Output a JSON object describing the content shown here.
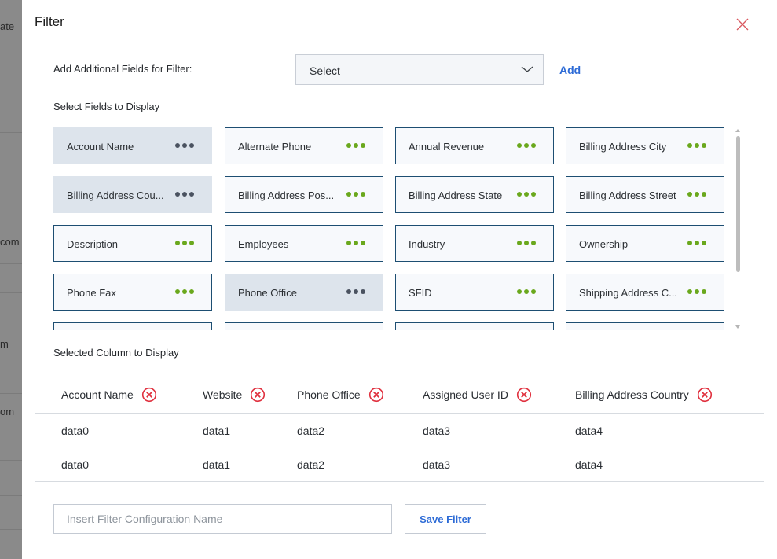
{
  "background": {
    "fragments": [
      "ate",
      "com",
      "m",
      "om"
    ]
  },
  "modal": {
    "title": "Filter",
    "add_fields_label": "Add Additional Fields for Filter:",
    "select_value": "Select",
    "add_label": "Add",
    "select_fields_label": "Select Fields to Display",
    "fields": [
      {
        "label": "Account Name",
        "selected": true
      },
      {
        "label": "Alternate Phone",
        "selected": false
      },
      {
        "label": "Annual Revenue",
        "selected": false
      },
      {
        "label": "Billing Address City",
        "selected": false
      },
      {
        "label": "Billing Address Cou...",
        "selected": true
      },
      {
        "label": "Billing Address Pos...",
        "selected": false
      },
      {
        "label": "Billing Address State",
        "selected": false
      },
      {
        "label": "Billing Address Street",
        "selected": false
      },
      {
        "label": "Description",
        "selected": false
      },
      {
        "label": "Employees",
        "selected": false
      },
      {
        "label": "Industry",
        "selected": false
      },
      {
        "label": "Ownership",
        "selected": false
      },
      {
        "label": "Phone Fax",
        "selected": false
      },
      {
        "label": "Phone Office",
        "selected": true
      },
      {
        "label": "SFID",
        "selected": false
      },
      {
        "label": "Shipping Address C...",
        "selected": false
      }
    ],
    "selected_columns_label": "Selected Column to Display",
    "columns": [
      "Account Name",
      "Website",
      "Phone Office",
      "Assigned User ID",
      "Billing Address Country"
    ],
    "rows": [
      [
        "data0",
        "data1",
        "data2",
        "data3",
        "data4"
      ],
      [
        "data0",
        "data1",
        "data2",
        "data3",
        "data4"
      ]
    ],
    "config_placeholder": "Insert Filter Configuration Name",
    "save_label": "Save Filter"
  },
  "colors": {
    "accent_blue": "#2d6bd6",
    "chip_border": "#1d4e72",
    "dots_green": "#6aa81d",
    "remove_red": "#e0303e"
  }
}
